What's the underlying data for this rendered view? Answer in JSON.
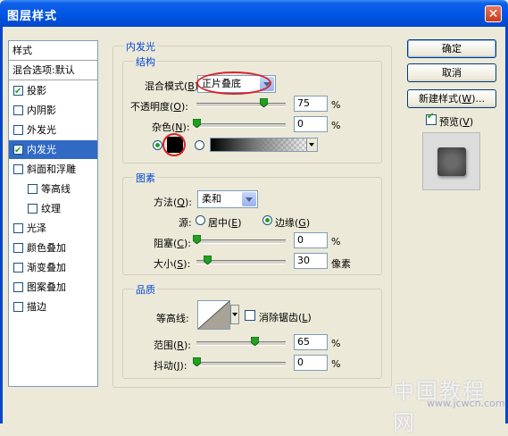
{
  "window": {
    "title": "图层样式",
    "close_glyph": "✕"
  },
  "style_list": {
    "header": "样式",
    "blend_options": "混合选项:默认",
    "items": [
      {
        "label": "投影",
        "checked": true
      },
      {
        "label": "内阴影",
        "checked": false
      },
      {
        "label": "外发光",
        "checked": false
      },
      {
        "label": "内发光",
        "checked": true,
        "selected": true
      },
      {
        "label": "斜面和浮雕",
        "checked": false
      },
      {
        "label": "等高线",
        "checked": false
      },
      {
        "label": "纹理",
        "checked": false
      },
      {
        "label": "光泽",
        "checked": false
      },
      {
        "label": "颜色叠加",
        "checked": false
      },
      {
        "label": "渐变叠加",
        "checked": false
      },
      {
        "label": "图案叠加",
        "checked": false
      },
      {
        "label": "描边",
        "checked": false
      }
    ]
  },
  "panel": {
    "title": "内发光",
    "structure": {
      "title": "结构",
      "blend_mode_label": "混合模式",
      "blend_mode_key": "B",
      "blend_mode_value": "正片叠底",
      "opacity_label": "不透明度",
      "opacity_key": "O",
      "opacity_value": "75",
      "opacity_unit": "%",
      "opacity_level": 0.75,
      "noise_label": "杂色",
      "noise_key": "N",
      "noise_value": "0",
      "noise_unit": "%",
      "noise_level": 0,
      "color_swatch": "#000000"
    },
    "elements": {
      "title": "图素",
      "technique_label": "方法",
      "technique_key": "Q",
      "technique_value": "柔和",
      "source_label": "源:",
      "source_center": "居中",
      "source_center_key": "E",
      "source_edge": "边缘",
      "source_edge_key": "G",
      "choke_label": "阻塞",
      "choke_key": "C",
      "choke_value": "0",
      "choke_unit": "%",
      "choke_level": 0,
      "size_label": "大小",
      "size_key": "S",
      "size_value": "30",
      "size_unit": "像素",
      "size_level": 0.12
    },
    "quality": {
      "title": "品质",
      "contour_label": "等高线:",
      "anti_alias_label": "消除锯齿",
      "anti_alias_key": "L",
      "range_label": "范围",
      "range_key": "R",
      "range_value": "65",
      "range_unit": "%",
      "range_level": 0.65,
      "jitter_label": "抖动",
      "jitter_key": "J",
      "jitter_value": "0",
      "jitter_unit": "%",
      "jitter_level": 0
    }
  },
  "buttons": {
    "ok": "确定",
    "cancel": "取消",
    "new_style": "新建样式(",
    "new_style_key": "W",
    "new_style_tail": ")...",
    "preview": "预览(",
    "preview_key": "V",
    "preview_tail": ")"
  },
  "watermark": {
    "text": "中国教程网",
    "url": "www.jcwcn.com"
  },
  "colors": {
    "selection": "#316ac5",
    "group_title": "#0046d5",
    "highlight_ring": "#d8232a"
  }
}
